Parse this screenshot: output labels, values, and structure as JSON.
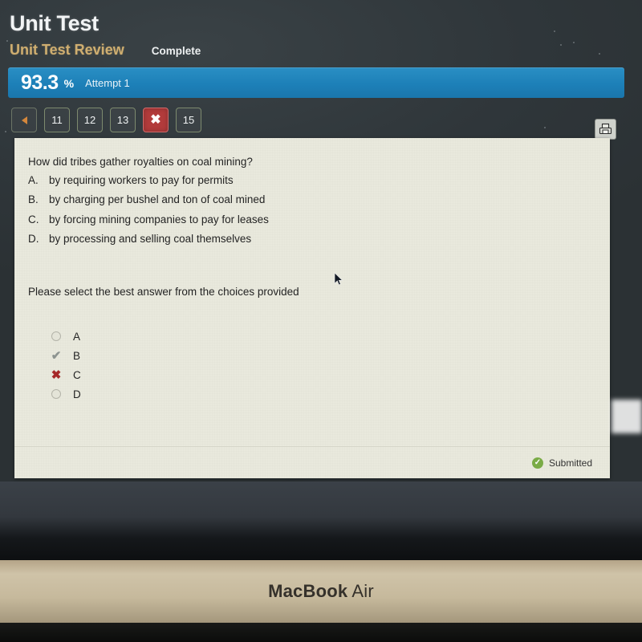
{
  "header": {
    "title": "Unit Test",
    "review_link": "Unit Test Review",
    "status": "Complete"
  },
  "score": {
    "percent": "93.3",
    "percent_sign": "%",
    "attempt": "Attempt 1",
    "bar_color": "#1d80b8"
  },
  "pager": {
    "prev_label": "",
    "items": [
      {
        "label": "11",
        "state": "normal"
      },
      {
        "label": "12",
        "state": "normal"
      },
      {
        "label": "13",
        "state": "normal"
      },
      {
        "label": "✖",
        "state": "current"
      },
      {
        "label": "15",
        "state": "normal"
      }
    ],
    "current_marker": "✖"
  },
  "toolbar": {
    "print_label": "print"
  },
  "question": {
    "prompt": "How did tribes gather royalties on coal mining?",
    "choices": [
      {
        "letter": "A.",
        "text": "by requiring workers to pay for permits"
      },
      {
        "letter": "B.",
        "text": "by charging per bushel and ton of coal mined"
      },
      {
        "letter": "C.",
        "text": "by forcing mining companies to pay for leases"
      },
      {
        "letter": "D.",
        "text": "by processing and selling coal themselves"
      }
    ],
    "instruction": "Please select the best answer from the choices provided"
  },
  "answers": [
    {
      "label": "A",
      "marker": "empty"
    },
    {
      "label": "B",
      "marker": "check"
    },
    {
      "label": "C",
      "marker": "cross"
    },
    {
      "label": "D",
      "marker": "empty"
    }
  ],
  "markers": {
    "check_glyph": "✔",
    "cross_glyph": "✖",
    "check_color": "#8d9490",
    "cross_color": "#a52828"
  },
  "footer": {
    "submitted_text": "Submitted",
    "submitted_glyph": "✓",
    "submitted_color": "#7aab46"
  },
  "device": {
    "brand_bold": "MacBook",
    "brand_light": "Air"
  }
}
